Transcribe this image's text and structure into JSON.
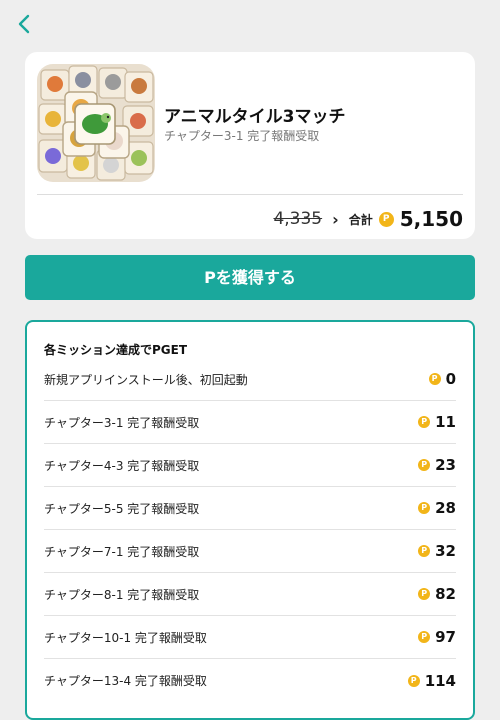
{
  "header": {
    "back_icon": "chevron-left-icon"
  },
  "app": {
    "title": "アニマルタイル3マッチ",
    "subtitle": "チャプター3-1 完了報酬受取",
    "icon": "animal-tile-app-icon"
  },
  "total": {
    "old_value": "4,335",
    "label": "合計",
    "coin_symbol": "P",
    "value": "5,150"
  },
  "cta": {
    "label": "Pを獲得する",
    "color": "#1aa89c"
  },
  "missions": {
    "title": "各ミッション達成でPGET",
    "items": [
      {
        "label": "新規アプリインストール後、初回起動",
        "points": "0"
      },
      {
        "label": "チャプター3-1 完了報酬受取",
        "points": "11"
      },
      {
        "label": "チャプター4-3 完了報酬受取",
        "points": "23"
      },
      {
        "label": "チャプター5-5 完了報酬受取",
        "points": "28"
      },
      {
        "label": "チャプター7-1 完了報酬受取",
        "points": "32"
      },
      {
        "label": "チャプター8-1 完了報酬受取",
        "points": "82"
      },
      {
        "label": "チャプター10-1 完了報酬受取",
        "points": "97"
      },
      {
        "label": "チャプター13-4 完了報酬受取",
        "points": "114"
      }
    ]
  },
  "colors": {
    "accent": "#1aa89c",
    "coin": "#f2b519",
    "background": "#eeeeee"
  }
}
